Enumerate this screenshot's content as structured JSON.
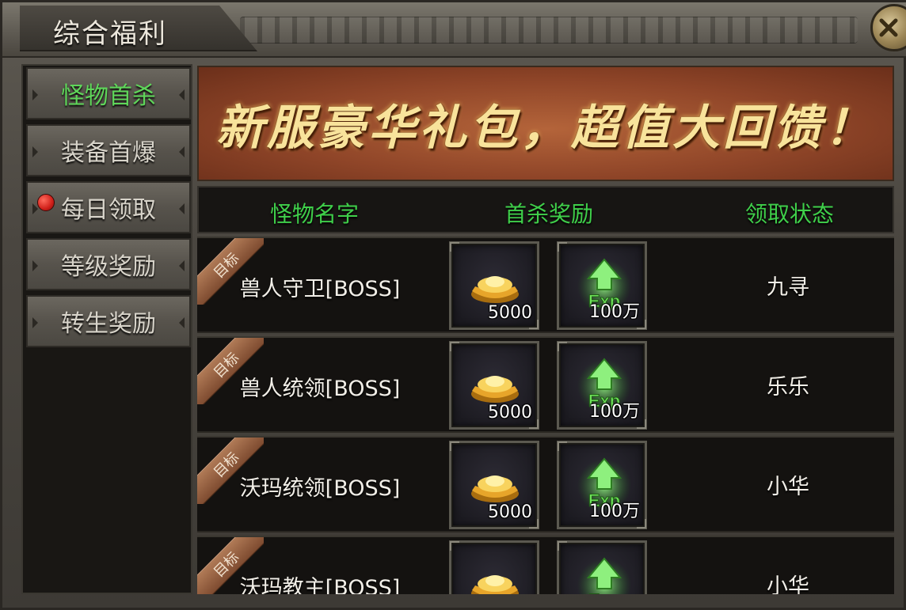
{
  "window": {
    "title": "综合福利"
  },
  "sidebar": {
    "items": [
      {
        "label": "怪物首杀",
        "active": true,
        "badge": false
      },
      {
        "label": "装备首爆",
        "active": false,
        "badge": false
      },
      {
        "label": "每日领取",
        "active": false,
        "badge": true
      },
      {
        "label": "等级奖励",
        "active": false,
        "badge": false
      },
      {
        "label": "转生奖励",
        "active": false,
        "badge": false
      }
    ]
  },
  "banner": {
    "text": "新服豪华礼包，超值大回馈！"
  },
  "table": {
    "headers": {
      "name": "怪物名字",
      "reward": "首杀奖励",
      "status": "领取状态"
    },
    "tag_label": "目标",
    "rows": [
      {
        "name": "兽人守卫[BOSS]",
        "gold": "5000",
        "exp": "100万",
        "status": "九寻"
      },
      {
        "name": "兽人统领[BOSS]",
        "gold": "5000",
        "exp": "100万",
        "status": "乐乐"
      },
      {
        "name": "沃玛统领[BOSS]",
        "gold": "5000",
        "exp": "100万",
        "status": "小华"
      },
      {
        "name": "沃玛教主[BOSS]",
        "gold": "",
        "exp": "",
        "status": "小华"
      }
    ]
  },
  "icons": {
    "close": "close-icon",
    "gold": "gold-ingot-icon",
    "exp": "exp-arrow-icon"
  },
  "colors": {
    "accent_green": "#3fcf4a",
    "active_tab": "#5fd65a",
    "banner_text": "#f8e39b",
    "badge_red": "#d0201a"
  }
}
